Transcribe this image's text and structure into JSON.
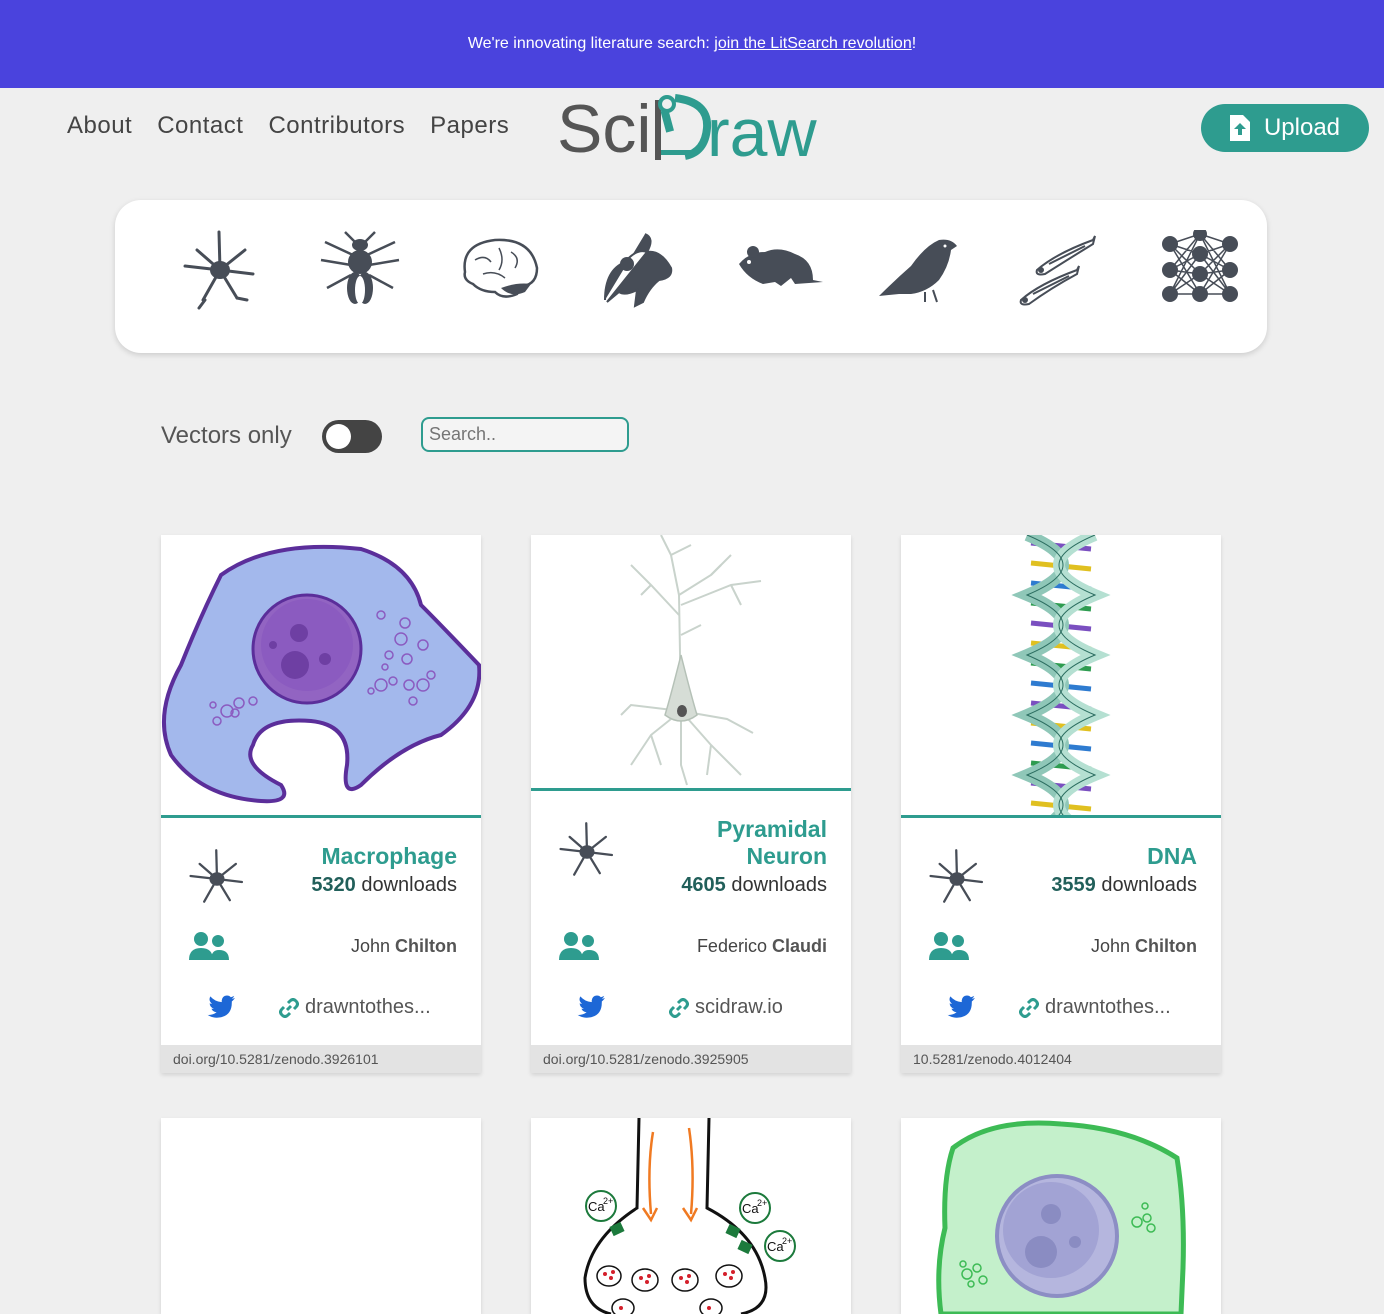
{
  "banner": {
    "text": "We're innovating literature search: ",
    "link": "join the LitSearch revolution",
    "suffix": "!"
  },
  "nav": {
    "about": "About",
    "contact": "Contact",
    "contributors": "Contributors",
    "papers": "Papers"
  },
  "logo": {
    "part1": "Sci",
    "part2": "raw"
  },
  "upload": {
    "label": "Upload"
  },
  "categories": [
    "neuron-icon",
    "fly-icon",
    "brain-icon",
    "mouse-icon",
    "rat-icon",
    "bird-icon",
    "zebrafish-icon",
    "network-icon"
  ],
  "filters": {
    "vectors_label": "Vectors only",
    "search_placeholder": "Search.."
  },
  "cards": [
    {
      "title": "Macrophage",
      "downloads": "5320",
      "downloads_label": " downloads",
      "author_first": "John ",
      "author_last": "Chilton",
      "link": "drawntothes...",
      "doi": "doi.org/10.5281/zenodo.3926101"
    },
    {
      "title_line1": "Pyramidal",
      "title_line2": "Neuron",
      "downloads": "4605",
      "downloads_label": " downloads",
      "author_first": "Federico ",
      "author_last": "Claudi",
      "link": "scidraw.io",
      "doi": "doi.org/10.5281/zenodo.3925905"
    },
    {
      "title": "DNA",
      "downloads": "3559",
      "downloads_label": " downloads",
      "author_first": "John ",
      "author_last": "Chilton",
      "link": "drawntothes...",
      "doi": "10.5281/zenodo.4012404"
    }
  ],
  "calcium_label": "Ca",
  "calcium_sup": "2+",
  "colors": {
    "banner": "#4a43dd",
    "accent": "#2e9c8f",
    "dark_icon": "#474d57"
  }
}
